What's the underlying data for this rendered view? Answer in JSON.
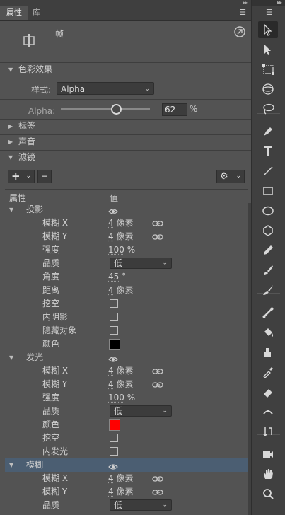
{
  "tabs": {
    "properties": "属性",
    "library": "库"
  },
  "object": {
    "type_label": "帧"
  },
  "color_effect": {
    "section_label": "色彩效果",
    "style_label": "样式:",
    "style_value": "Alpha",
    "alpha_label": "Alpha:",
    "alpha_value": "62",
    "alpha_unit": "%"
  },
  "sections": {
    "label": "标签",
    "sound": "声音",
    "filters": "滤镜"
  },
  "filters": {
    "add_button": "+",
    "remove_button": "−",
    "col_property": "属性",
    "col_value": "值",
    "rows": [
      {
        "kind": "group",
        "name": "投影",
        "expanded": true,
        "visible": true
      },
      {
        "kind": "link",
        "name": "模糊 X",
        "num": "4",
        "unit": "像素"
      },
      {
        "kind": "link",
        "name": "模糊 Y",
        "num": "4",
        "unit": "像素"
      },
      {
        "kind": "value",
        "name": "强度",
        "num": "100",
        "unit": "%"
      },
      {
        "kind": "select",
        "name": "品质",
        "value": "低"
      },
      {
        "kind": "value",
        "name": "角度",
        "num": "45",
        "unit": "°"
      },
      {
        "kind": "value",
        "name": "距离",
        "num": "4",
        "unit": "像素"
      },
      {
        "kind": "check",
        "name": "挖空",
        "checked": false
      },
      {
        "kind": "check",
        "name": "内阴影",
        "checked": false
      },
      {
        "kind": "check",
        "name": "隐藏对象",
        "checked": false
      },
      {
        "kind": "color",
        "name": "颜色",
        "color": "#000000"
      },
      {
        "kind": "group",
        "name": "发光",
        "expanded": true,
        "visible": true
      },
      {
        "kind": "link",
        "name": "模糊 X",
        "num": "4",
        "unit": "像素"
      },
      {
        "kind": "link",
        "name": "模糊 Y",
        "num": "4",
        "unit": "像素"
      },
      {
        "kind": "value",
        "name": "强度",
        "num": "100",
        "unit": "%"
      },
      {
        "kind": "select",
        "name": "品质",
        "value": "低"
      },
      {
        "kind": "color",
        "name": "颜色",
        "color": "#ff0000"
      },
      {
        "kind": "check",
        "name": "挖空",
        "checked": false
      },
      {
        "kind": "check",
        "name": "内发光",
        "checked": false
      },
      {
        "kind": "group",
        "name": "模糊",
        "expanded": true,
        "visible": true,
        "highlighted": true
      },
      {
        "kind": "link",
        "name": "模糊 X",
        "num": "4",
        "unit": "像素"
      },
      {
        "kind": "link",
        "name": "模糊 Y",
        "num": "4",
        "unit": "像素"
      },
      {
        "kind": "select",
        "name": "品质",
        "value": "低"
      }
    ]
  },
  "toolbar": {
    "tools": [
      "selection-tool",
      "subselection-tool",
      "free-transform-tool",
      "3d-rotation-tool",
      "lasso-tool",
      "pen-tool",
      "text-tool",
      "line-tool",
      "rectangle-tool",
      "oval-tool",
      "polystar-tool",
      "pencil-tool",
      "paint-brush-tool",
      "brush-tool",
      "bone-tool",
      "paint-bucket-tool",
      "ink-bottle-tool",
      "eyedropper-tool",
      "eraser-tool",
      "width-tool",
      "asset-warp-tool",
      "camera-tool",
      "hand-tool",
      "zoom-tool"
    ]
  },
  "colors": {
    "panel": "#535353",
    "highlight": "#4b5e72",
    "accent_red": "#ff0000"
  }
}
